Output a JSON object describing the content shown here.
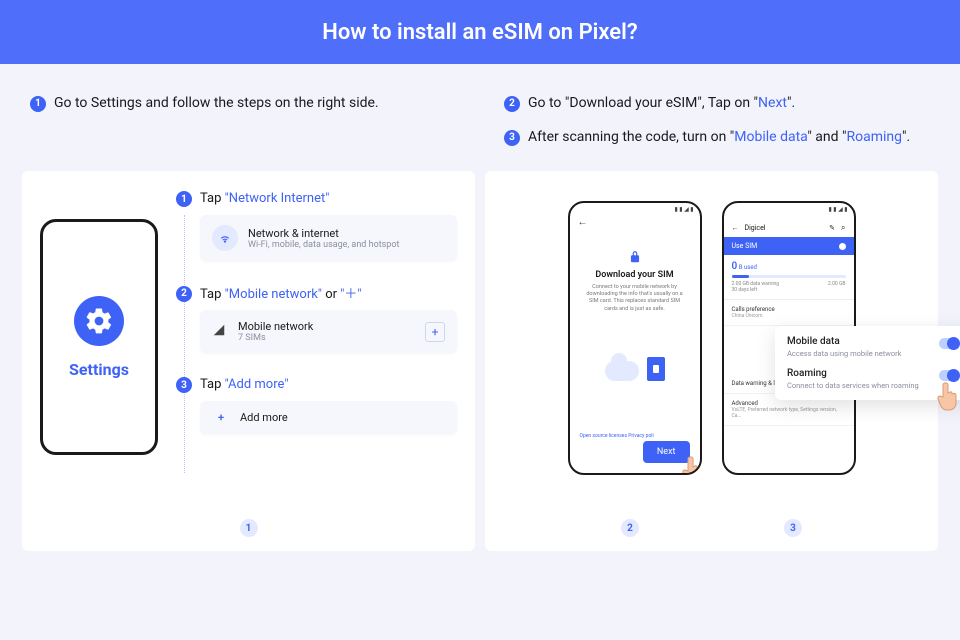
{
  "header": {
    "title": "How to install an eSIM on Pixel?"
  },
  "intro": {
    "left": {
      "n": "1",
      "text": "Go to Settings and follow the steps on the right side."
    },
    "right2": {
      "n": "2",
      "pre": "Go to \"Download your eSIM\", Tap on \"",
      "hl": "Next",
      "post": "\"."
    },
    "right3": {
      "n": "3",
      "pre": "After scanning the code, turn on \"",
      "hl1": "Mobile data",
      "mid": "\" and \"",
      "hl2": "Roaming",
      "post": "\"."
    }
  },
  "panelA": {
    "settings_label": "Settings",
    "s1": {
      "n": "1",
      "lead": "Tap ",
      "hl": "\"Network Internet\"",
      "card": {
        "title": "Network & internet",
        "sub": "Wi-Fi, mobile, data usage, and hotspot"
      }
    },
    "s2": {
      "n": "2",
      "lead": "Tap ",
      "hl": "\"Mobile network\"",
      "mid": " or ",
      "hl2": "\"＋\"",
      "card": {
        "title": "Mobile network",
        "sub": "7 SIMs"
      }
    },
    "s3": {
      "n": "3",
      "lead": "Tap ",
      "hl": "\"Add more\"",
      "card": {
        "title": "Add more"
      }
    },
    "badge": "1"
  },
  "panelB": {
    "phone2": {
      "title": "Download your SIM",
      "sub": "Connect to your mobile network by downloading the info that's usually on a SIM card. This replaces standard SIM cards and is just as safe.",
      "legal": "Open source licenses  Privacy poli",
      "next": "Next"
    },
    "phone3": {
      "carrier": "Digicel",
      "use_sim": "Use SIM",
      "used_label": "0",
      "used_unit": "B used",
      "warn": "2.00 GB data warning",
      "days": "30 days left",
      "cap": "2.00 GB",
      "li1": {
        "t": "Calls preference",
        "s": "China Unicom"
      },
      "li2": {
        "t": "Data warning & limit"
      },
      "li3": {
        "t": "Advanced",
        "s": "VoLTE, Preferred network type, Settings version, Ca…"
      }
    },
    "popup": {
      "r1": {
        "t": "Mobile data",
        "s": "Access data using mobile network"
      },
      "r2": {
        "t": "Roaming",
        "s": "Connect to data services when roaming"
      }
    },
    "badge2": "2",
    "badge3": "3"
  }
}
